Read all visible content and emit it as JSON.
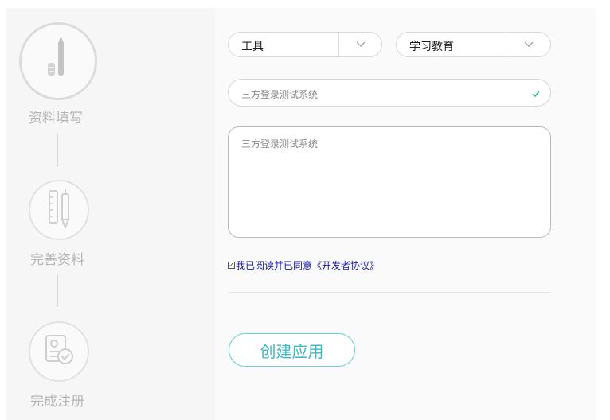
{
  "steps": [
    {
      "label": "资料填写",
      "icon": "pen-icon"
    },
    {
      "label": "完善资料",
      "icon": "ruler-pencil-icon"
    },
    {
      "label": "完成注册",
      "icon": "document-check-icon"
    }
  ],
  "form": {
    "category_primary": "工具",
    "category_secondary": "学习教育",
    "app_name": "三方登录测试系统",
    "app_description": "三方登录测试系统",
    "agreement_text": "我已阅读并已同意《开发者协议》",
    "agreement_checked": true,
    "submit_label": "创建应用"
  },
  "colors": {
    "accent": "#3fb9c4",
    "valid": "#2bbf8a",
    "link": "#1a1aa6"
  }
}
